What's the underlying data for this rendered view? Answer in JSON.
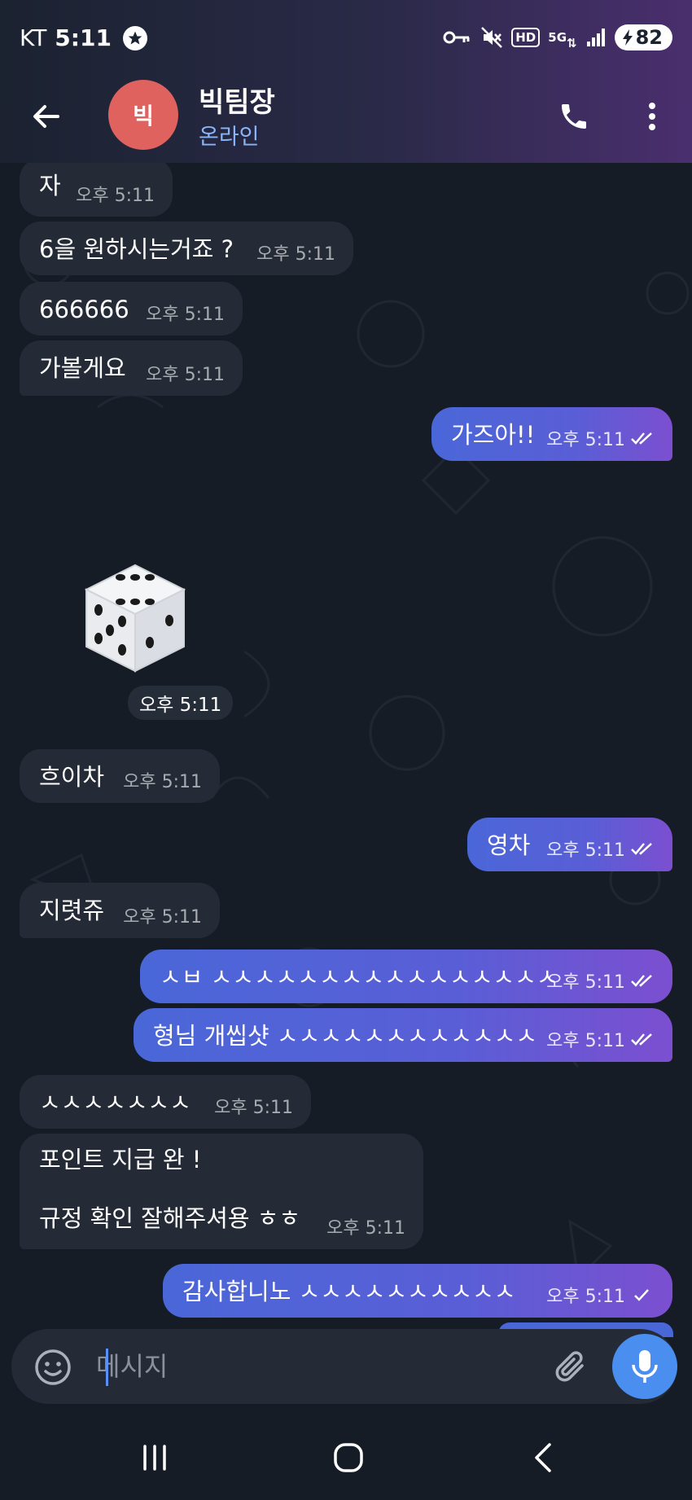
{
  "status_bar": {
    "carrier": "KT",
    "time": "5:11",
    "battery": "82",
    "network": "5G",
    "hd_label": "HD"
  },
  "header": {
    "avatar_text": "빅",
    "name": "빅팀장",
    "status": "온라인",
    "avatar_color": "#e0625f"
  },
  "messages": [
    {
      "side": "in",
      "text": "자",
      "time": "오후 5:11"
    },
    {
      "side": "in",
      "text": "6을 원하시는거죠 ?",
      "time": "오후 5:11"
    },
    {
      "side": "in",
      "text": "666666",
      "time": "오후 5:11"
    },
    {
      "side": "in",
      "text": "가볼게요",
      "time": "오후 5:11"
    },
    {
      "side": "out",
      "text": "가즈아!!",
      "time": "오후 5:11",
      "read": true
    },
    {
      "side": "in",
      "sticker": "dice",
      "time": "오후 5:11"
    },
    {
      "side": "in",
      "text": "흐이차",
      "time": "오후 5:11"
    },
    {
      "side": "out",
      "text": "영차",
      "time": "오후 5:11",
      "read": true
    },
    {
      "side": "in",
      "text": "지렷쥬",
      "time": "오후 5:11"
    },
    {
      "side": "out",
      "text": "ㅅㅂ ㅅㅅㅅㅅㅅㅅㅅㅅㅅㅅㅅㅅㅅㅅㅅㅅ",
      "time": "오후 5:11",
      "read": true
    },
    {
      "side": "out",
      "text": "형님 개씹샷 ㅅㅅㅅㅅㅅㅅㅅㅅㅅㅅㅅㅅ",
      "time": "오후 5:11",
      "read": true
    },
    {
      "side": "in",
      "text": "ㅅㅅㅅㅅㅅㅅㅅ",
      "time": "오후 5:11"
    },
    {
      "side": "in",
      "text": "포인트 지급 완 !\n\n규정 확인 잘해주셔용 ㅎㅎ",
      "time": "오후 5:11"
    },
    {
      "side": "out",
      "text": "감사합니노 ㅅㅅㅅㅅㅅㅅㅅㅅㅅㅅ",
      "time": "오후 5:11",
      "read": false
    }
  ],
  "composer": {
    "placeholder": "메시지"
  },
  "colors": {
    "incoming_bubble": "#242b36",
    "outgoing_bubble": "#5a5ed6",
    "background": "#161c26",
    "accent": "#4a8ff0"
  }
}
